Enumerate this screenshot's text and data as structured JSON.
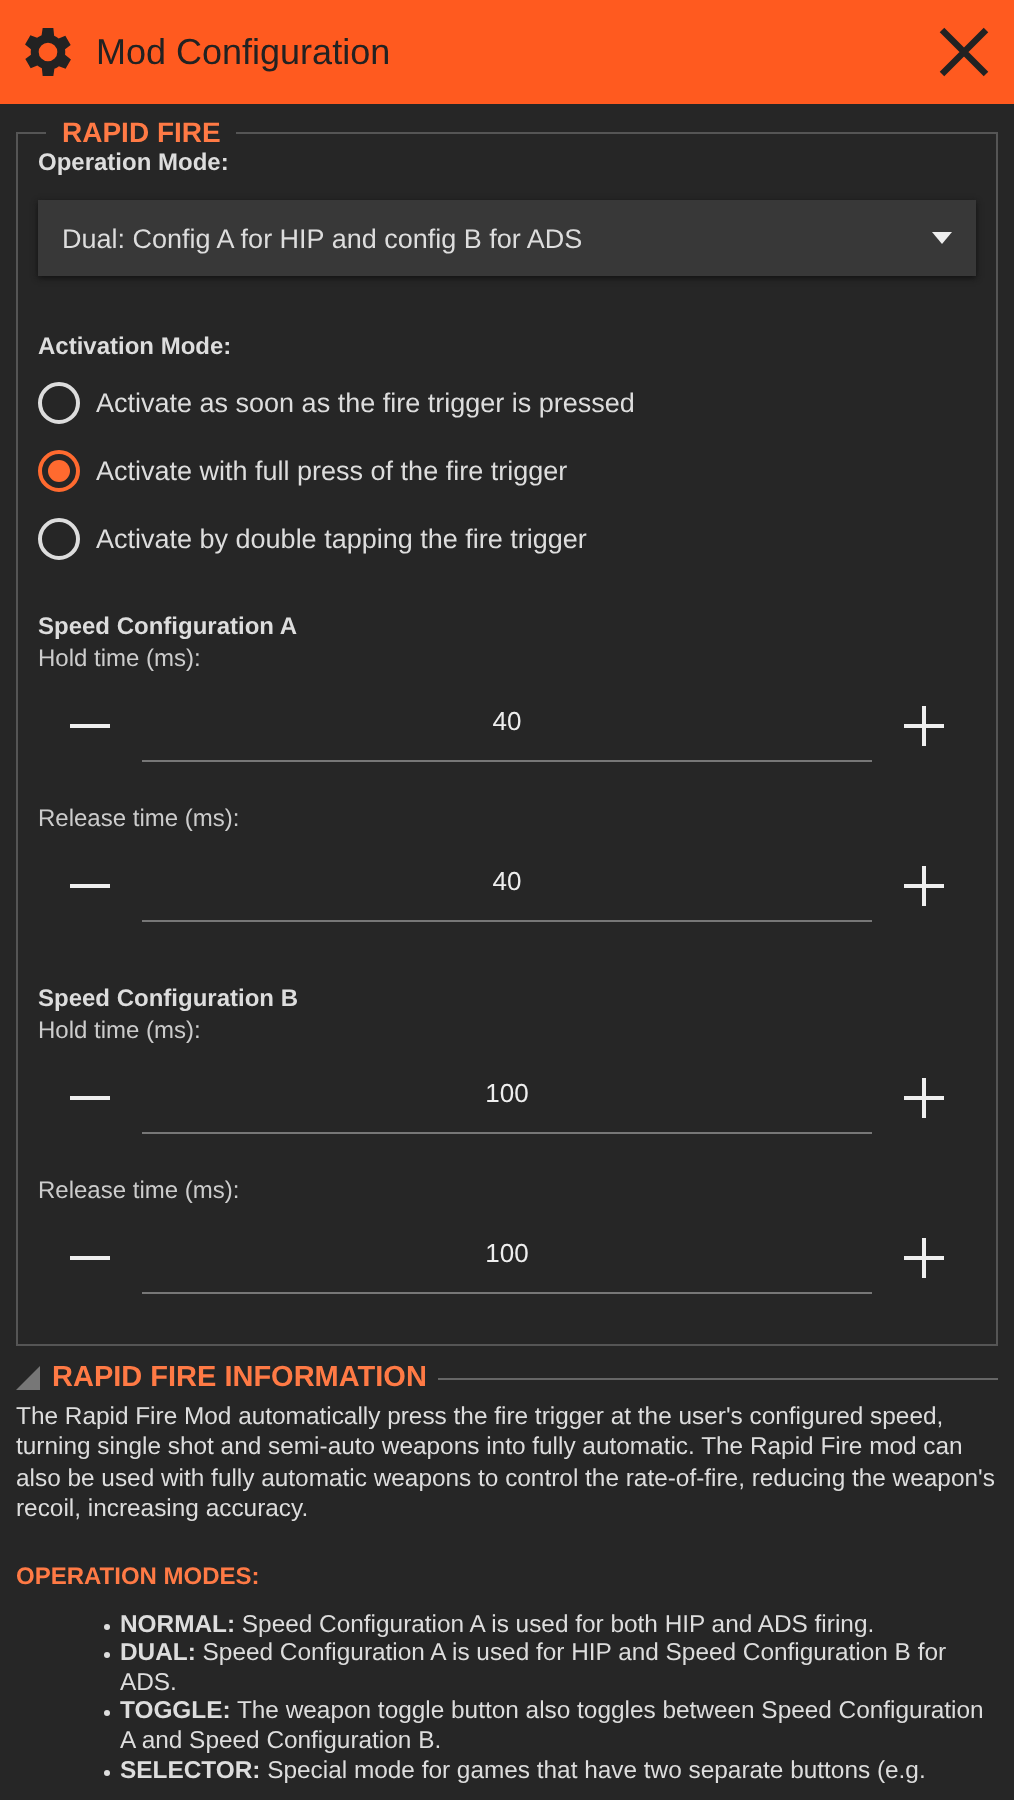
{
  "header": {
    "title": "Mod Configuration"
  },
  "rapid_fire": {
    "title": "RAPID FIRE",
    "operation_mode": {
      "label": "Operation Mode:",
      "value": "Dual: Config A for HIP and config B for ADS"
    },
    "activation_mode": {
      "label": "Activation Mode:",
      "options": [
        {
          "label": "Activate as soon as the fire trigger is pressed",
          "selected": false
        },
        {
          "label": "Activate with full press of the fire trigger",
          "selected": true
        },
        {
          "label": "Activate by double tapping the fire trigger",
          "selected": false
        }
      ]
    },
    "speed_configs": [
      {
        "title": "Speed Configuration A",
        "fields": [
          {
            "label": "Hold time (ms):",
            "value": "40"
          },
          {
            "label": "Release time (ms):",
            "value": "40"
          }
        ]
      },
      {
        "title": "Speed Configuration B",
        "fields": [
          {
            "label": "Hold time (ms):",
            "value": "100"
          },
          {
            "label": "Release time (ms):",
            "value": "100"
          }
        ]
      }
    ]
  },
  "information": {
    "title": "RAPID FIRE INFORMATION",
    "description": "The Rapid Fire Mod automatically press the fire trigger at the user's configured speed, turning single shot and semi-auto weapons into fully automatic. The Rapid Fire mod can also be used with fully automatic weapons to control the rate-of-fire, reducing the weapon's recoil, increasing accuracy.",
    "modes_title": "OPERATION MODES:",
    "modes": [
      "**NORMAL:** Speed Configuration A is used for both HIP and ADS firing.",
      "**DUAL:** Speed Configuration A is used for HIP and Speed Configuration B for ADS.",
      "**TOGGLE:** The weapon toggle button also toggles between Speed Configuration A and Speed Configuration B.",
      "**SELECTOR:** Special mode for games that have two separate buttons (e.g."
    ]
  }
}
